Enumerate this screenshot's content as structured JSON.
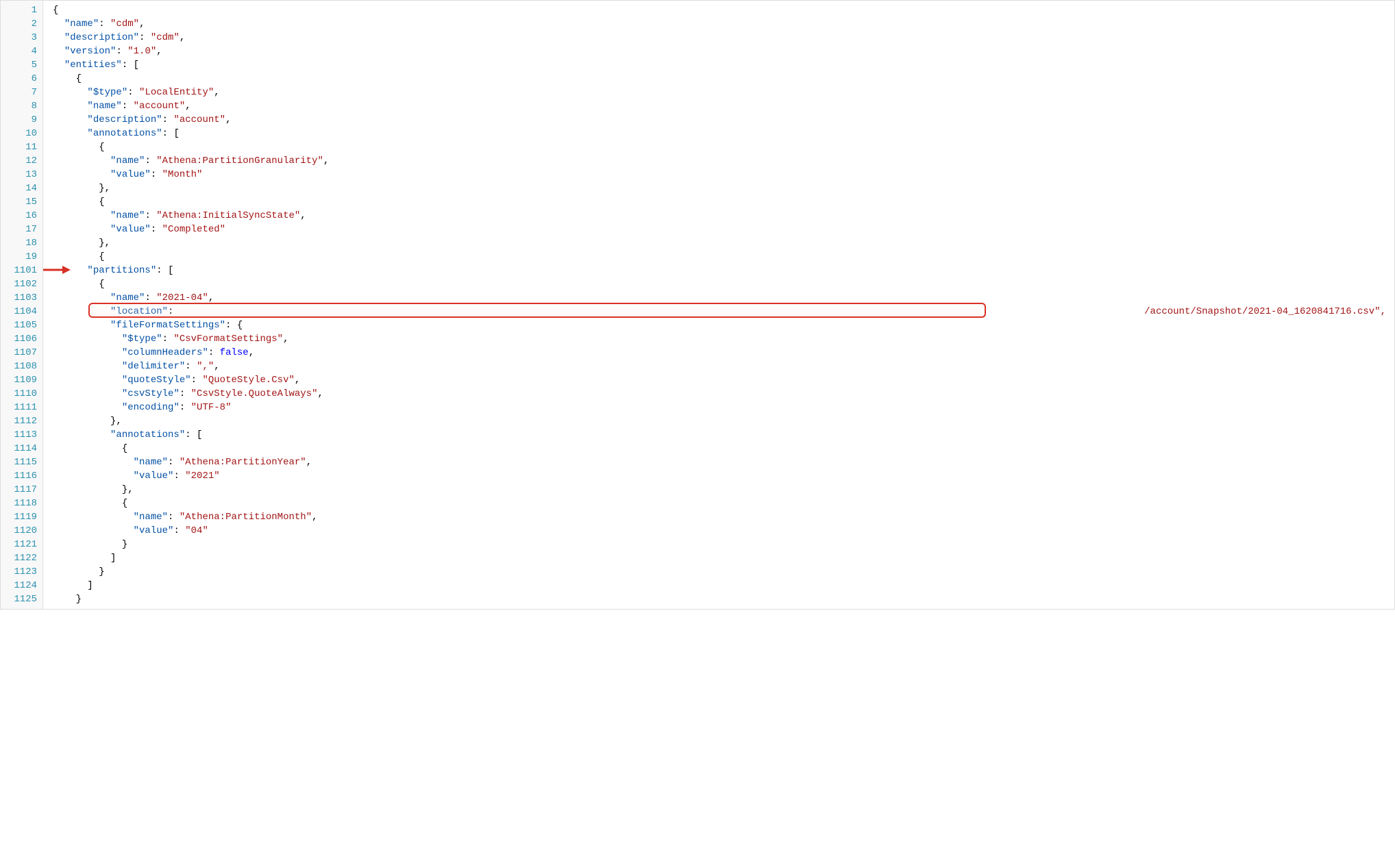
{
  "lines": [
    {
      "num": "1",
      "tokens": [
        {
          "t": "{",
          "c": "pun",
          "i": 0
        }
      ]
    },
    {
      "num": "2",
      "tokens": [
        {
          "t": "\"name\"",
          "c": "key",
          "i": 1
        },
        {
          "t": ": ",
          "c": "pun"
        },
        {
          "t": "\"cdm\"",
          "c": "str"
        },
        {
          "t": ",",
          "c": "pun"
        }
      ]
    },
    {
      "num": "3",
      "tokens": [
        {
          "t": "\"description\"",
          "c": "key",
          "i": 1
        },
        {
          "t": ": ",
          "c": "pun"
        },
        {
          "t": "\"cdm\"",
          "c": "str"
        },
        {
          "t": ",",
          "c": "pun"
        }
      ]
    },
    {
      "num": "4",
      "tokens": [
        {
          "t": "\"version\"",
          "c": "key",
          "i": 1
        },
        {
          "t": ": ",
          "c": "pun"
        },
        {
          "t": "\"1.0\"",
          "c": "str"
        },
        {
          "t": ",",
          "c": "pun"
        }
      ]
    },
    {
      "num": "5",
      "tokens": [
        {
          "t": "\"entities\"",
          "c": "key",
          "i": 1
        },
        {
          "t": ": [",
          "c": "pun"
        }
      ]
    },
    {
      "num": "6",
      "tokens": [
        {
          "t": "{",
          "c": "pun",
          "i": 2
        }
      ]
    },
    {
      "num": "7",
      "tokens": [
        {
          "t": "\"$type\"",
          "c": "key",
          "i": 3
        },
        {
          "t": ": ",
          "c": "pun"
        },
        {
          "t": "\"LocalEntity\"",
          "c": "str"
        },
        {
          "t": ",",
          "c": "pun"
        }
      ]
    },
    {
      "num": "8",
      "tokens": [
        {
          "t": "\"name\"",
          "c": "key",
          "i": 3
        },
        {
          "t": ": ",
          "c": "pun"
        },
        {
          "t": "\"account\"",
          "c": "str"
        },
        {
          "t": ",",
          "c": "pun"
        }
      ]
    },
    {
      "num": "9",
      "tokens": [
        {
          "t": "\"description\"",
          "c": "key",
          "i": 3
        },
        {
          "t": ": ",
          "c": "pun"
        },
        {
          "t": "\"account\"",
          "c": "str"
        },
        {
          "t": ",",
          "c": "pun"
        }
      ]
    },
    {
      "num": "10",
      "tokens": [
        {
          "t": "\"annotations\"",
          "c": "key",
          "i": 3
        },
        {
          "t": ": [",
          "c": "pun"
        }
      ]
    },
    {
      "num": "11",
      "tokens": [
        {
          "t": "{",
          "c": "pun",
          "i": 4
        }
      ]
    },
    {
      "num": "12",
      "tokens": [
        {
          "t": "\"name\"",
          "c": "key",
          "i": 5
        },
        {
          "t": ": ",
          "c": "pun"
        },
        {
          "t": "\"Athena:PartitionGranularity\"",
          "c": "str"
        },
        {
          "t": ",",
          "c": "pun"
        }
      ]
    },
    {
      "num": "13",
      "tokens": [
        {
          "t": "\"value\"",
          "c": "key",
          "i": 5
        },
        {
          "t": ": ",
          "c": "pun"
        },
        {
          "t": "\"Month\"",
          "c": "str"
        }
      ]
    },
    {
      "num": "14",
      "tokens": [
        {
          "t": "},",
          "c": "pun",
          "i": 4
        }
      ]
    },
    {
      "num": "15",
      "tokens": [
        {
          "t": "{",
          "c": "pun",
          "i": 4
        }
      ]
    },
    {
      "num": "16",
      "tokens": [
        {
          "t": "\"name\"",
          "c": "key",
          "i": 5
        },
        {
          "t": ": ",
          "c": "pun"
        },
        {
          "t": "\"Athena:InitialSyncState\"",
          "c": "str"
        },
        {
          "t": ",",
          "c": "pun"
        }
      ]
    },
    {
      "num": "17",
      "tokens": [
        {
          "t": "\"value\"",
          "c": "key",
          "i": 5
        },
        {
          "t": ": ",
          "c": "pun"
        },
        {
          "t": "\"Completed\"",
          "c": "str"
        }
      ]
    },
    {
      "num": "18",
      "tokens": [
        {
          "t": "},",
          "c": "pun",
          "i": 4
        }
      ]
    },
    {
      "num": "19",
      "tokens": [
        {
          "t": "{",
          "c": "pun",
          "i": 4
        }
      ]
    },
    {
      "num": "1101",
      "tokens": [
        {
          "t": "\"partitions\"",
          "c": "key",
          "i": 3
        },
        {
          "t": ": [",
          "c": "pun"
        }
      ]
    },
    {
      "num": "1102",
      "tokens": [
        {
          "t": "{",
          "c": "pun",
          "i": 4
        }
      ]
    },
    {
      "num": "1103",
      "tokens": [
        {
          "t": "\"name\"",
          "c": "key",
          "i": 5
        },
        {
          "t": ": ",
          "c": "pun"
        },
        {
          "t": "\"2021-04\"",
          "c": "str"
        },
        {
          "t": ",",
          "c": "pun"
        }
      ]
    },
    {
      "num": "1104",
      "tokens": [
        {
          "t": "\"location\"",
          "c": "key",
          "i": 5
        },
        {
          "t": ": ",
          "c": "pun"
        }
      ]
    },
    {
      "num": "1105",
      "tokens": [
        {
          "t": "\"fileFormatSettings\"",
          "c": "key",
          "i": 5
        },
        {
          "t": ": {",
          "c": "pun"
        }
      ]
    },
    {
      "num": "1106",
      "tokens": [
        {
          "t": "\"$type\"",
          "c": "key",
          "i": 6
        },
        {
          "t": ": ",
          "c": "pun"
        },
        {
          "t": "\"CsvFormatSettings\"",
          "c": "str"
        },
        {
          "t": ",",
          "c": "pun"
        }
      ]
    },
    {
      "num": "1107",
      "tokens": [
        {
          "t": "\"columnHeaders\"",
          "c": "key",
          "i": 6
        },
        {
          "t": ": ",
          "c": "pun"
        },
        {
          "t": "false",
          "c": "kw"
        },
        {
          "t": ",",
          "c": "pun"
        }
      ]
    },
    {
      "num": "1108",
      "tokens": [
        {
          "t": "\"delimiter\"",
          "c": "key",
          "i": 6
        },
        {
          "t": ": ",
          "c": "pun"
        },
        {
          "t": "\",\"",
          "c": "str"
        },
        {
          "t": ",",
          "c": "pun"
        }
      ]
    },
    {
      "num": "1109",
      "tokens": [
        {
          "t": "\"quoteStyle\"",
          "c": "key",
          "i": 6
        },
        {
          "t": ": ",
          "c": "pun"
        },
        {
          "t": "\"QuoteStyle.Csv\"",
          "c": "str"
        },
        {
          "t": ",",
          "c": "pun"
        }
      ]
    },
    {
      "num": "1110",
      "tokens": [
        {
          "t": "\"csvStyle\"",
          "c": "key",
          "i": 6
        },
        {
          "t": ": ",
          "c": "pun"
        },
        {
          "t": "\"CsvStyle.QuoteAlways\"",
          "c": "str"
        },
        {
          "t": ",",
          "c": "pun"
        }
      ]
    },
    {
      "num": "1111",
      "tokens": [
        {
          "t": "\"encoding\"",
          "c": "key",
          "i": 6
        },
        {
          "t": ": ",
          "c": "pun"
        },
        {
          "t": "\"UTF-8\"",
          "c": "str"
        }
      ]
    },
    {
      "num": "1112",
      "tokens": [
        {
          "t": "},",
          "c": "pun",
          "i": 5
        }
      ]
    },
    {
      "num": "1113",
      "tokens": [
        {
          "t": "\"annotations\"",
          "c": "key",
          "i": 5
        },
        {
          "t": ": [",
          "c": "pun"
        }
      ]
    },
    {
      "num": "1114",
      "tokens": [
        {
          "t": "{",
          "c": "pun",
          "i": 6
        }
      ]
    },
    {
      "num": "1115",
      "tokens": [
        {
          "t": "\"name\"",
          "c": "key",
          "i": 7
        },
        {
          "t": ": ",
          "c": "pun"
        },
        {
          "t": "\"Athena:PartitionYear\"",
          "c": "str"
        },
        {
          "t": ",",
          "c": "pun"
        }
      ]
    },
    {
      "num": "1116",
      "tokens": [
        {
          "t": "\"value\"",
          "c": "key",
          "i": 7
        },
        {
          "t": ": ",
          "c": "pun"
        },
        {
          "t": "\"2021\"",
          "c": "str"
        }
      ]
    },
    {
      "num": "1117",
      "tokens": [
        {
          "t": "},",
          "c": "pun",
          "i": 6
        }
      ]
    },
    {
      "num": "1118",
      "tokens": [
        {
          "t": "{",
          "c": "pun",
          "i": 6
        }
      ]
    },
    {
      "num": "1119",
      "tokens": [
        {
          "t": "\"name\"",
          "c": "key",
          "i": 7
        },
        {
          "t": ": ",
          "c": "pun"
        },
        {
          "t": "\"Athena:PartitionMonth\"",
          "c": "str"
        },
        {
          "t": ",",
          "c": "pun"
        }
      ]
    },
    {
      "num": "1120",
      "tokens": [
        {
          "t": "\"value\"",
          "c": "key",
          "i": 7
        },
        {
          "t": ": ",
          "c": "pun"
        },
        {
          "t": "\"04\"",
          "c": "str"
        }
      ]
    },
    {
      "num": "1121",
      "tokens": [
        {
          "t": "}",
          "c": "pun",
          "i": 6
        }
      ]
    },
    {
      "num": "1122",
      "tokens": [
        {
          "t": "]",
          "c": "pun",
          "i": 5
        }
      ]
    },
    {
      "num": "1123",
      "tokens": [
        {
          "t": "}",
          "c": "pun",
          "i": 4
        }
      ]
    },
    {
      "num": "1124",
      "tokens": [
        {
          "t": "]",
          "c": "pun",
          "i": 3
        }
      ]
    },
    {
      "num": "1125",
      "tokens": [
        {
          "t": "}",
          "c": "pun",
          "i": 2
        }
      ]
    }
  ],
  "location_tail": "/account/Snapshot/2021-04_1620841716.csv\",",
  "indent_unit": "  "
}
